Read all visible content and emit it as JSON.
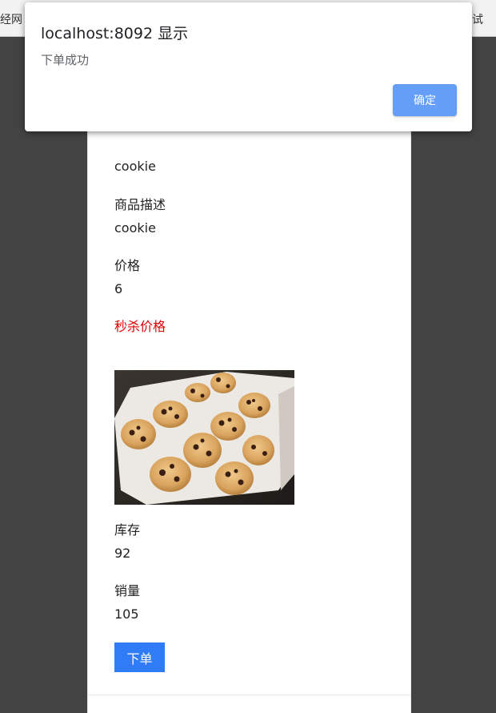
{
  "browser": {
    "bookmark_left_fragment": "经网",
    "bookmark_right_fragment": "试"
  },
  "dialog": {
    "title": "localhost:8092 显示",
    "message": "下单成功",
    "confirm_label": "确定"
  },
  "product": {
    "name": "cookie",
    "description_label": "商品描述",
    "description": "cookie",
    "price_label": "价格",
    "price": "6",
    "seckill_price_label": "秒杀价格",
    "image_alt": "chocolate chip cookies on a baking tray",
    "stock_label": "库存",
    "stock": "92",
    "sales_label": "销量",
    "sales": "105",
    "order_button_label": "下单"
  },
  "colors": {
    "overlay": "#434343",
    "order_button": "#2f7cf6",
    "confirm_button": "#659ef7",
    "seckill_label": "#e00000"
  }
}
